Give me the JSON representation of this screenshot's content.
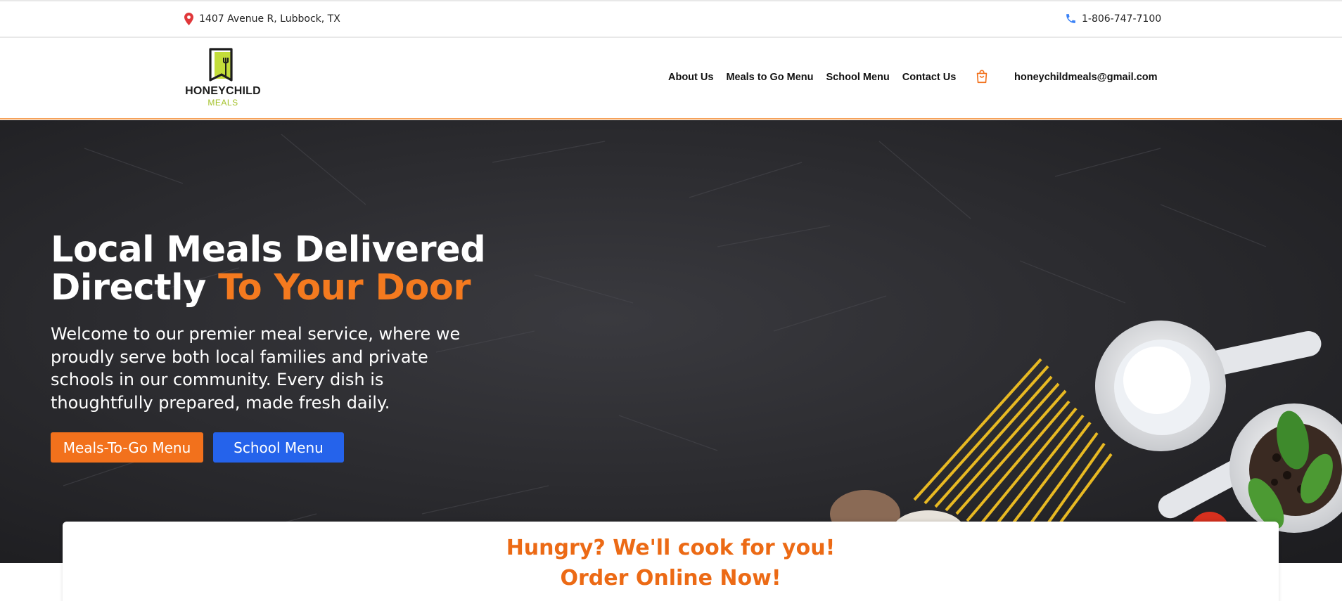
{
  "topbar": {
    "address": "1407 Avenue R, Lubbock, TX",
    "phone": "1-806-747-7100",
    "address_icon": "location-pin-icon",
    "phone_icon": "phone-icon"
  },
  "header": {
    "logo": {
      "name": "HONEYCHILD",
      "sub": "MEALS"
    },
    "nav": [
      {
        "label": "About Us"
      },
      {
        "label": "Meals to Go Menu"
      },
      {
        "label": "School Menu"
      },
      {
        "label": "Contact Us"
      }
    ],
    "cart_icon": "shopping-bag-icon",
    "email": "honeychildmeals@gmail.com"
  },
  "hero": {
    "title_line1": "Local Meals Delivered",
    "title_line2_white": "Directly ",
    "title_line2_accent": "To Your Door",
    "lead": "Welcome to our premier meal service, where we proudly serve both local families and private schools in our community. Every dish is thoughtfully prepared, made fresh daily.",
    "buttons": {
      "meals_to_go": "Meals-To-Go Menu",
      "school_menu": "School Menu"
    }
  },
  "order": {
    "line1": "Hungry? We'll cook for you!",
    "line2": "Order Online Now!"
  },
  "colors": {
    "accent_orange": "#f2711c",
    "button_blue": "#2563eb",
    "logo_green": "#a4c22a",
    "hero_bg": "#26262a"
  }
}
